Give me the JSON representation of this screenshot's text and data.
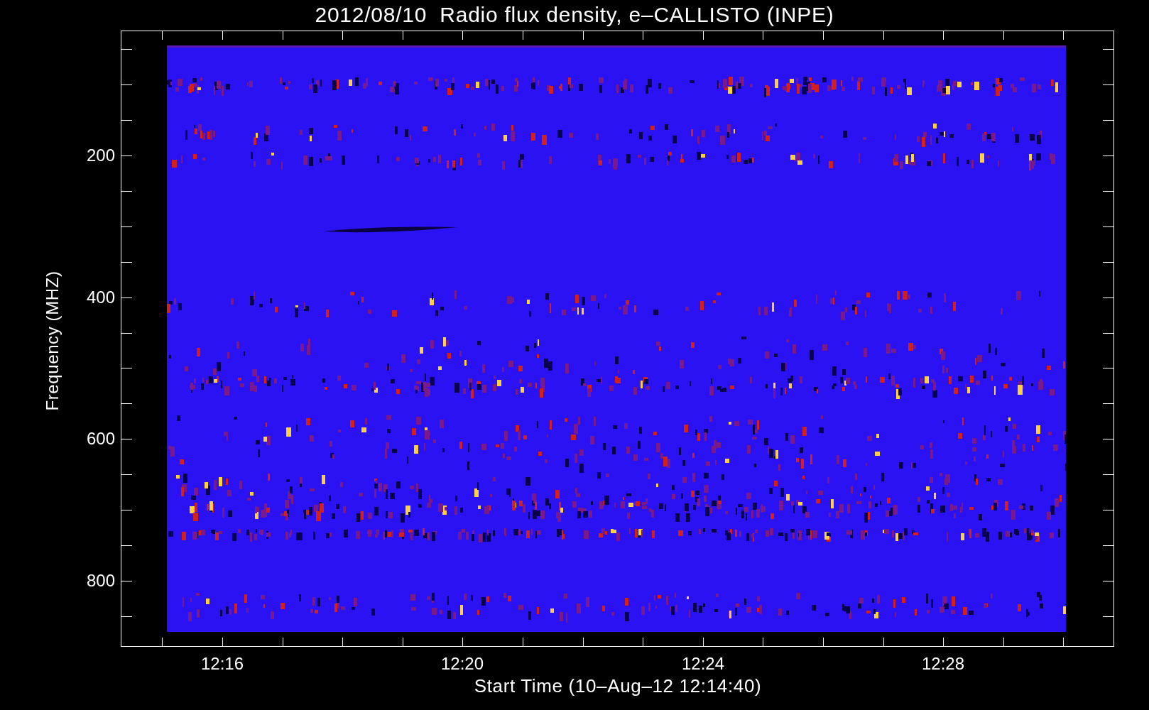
{
  "title": "2012/08/10  Radio flux density, e–CALLISTO (INPE)",
  "y_axis": {
    "label": "Frequency (MHZ)",
    "ticks": [
      "200",
      "400",
      "600",
      "800"
    ]
  },
  "x_axis": {
    "label": "Start Time (10–Aug–12 12:14:40)",
    "ticks": [
      "12:16",
      "12:20",
      "12:24",
      "12:28"
    ]
  }
}
